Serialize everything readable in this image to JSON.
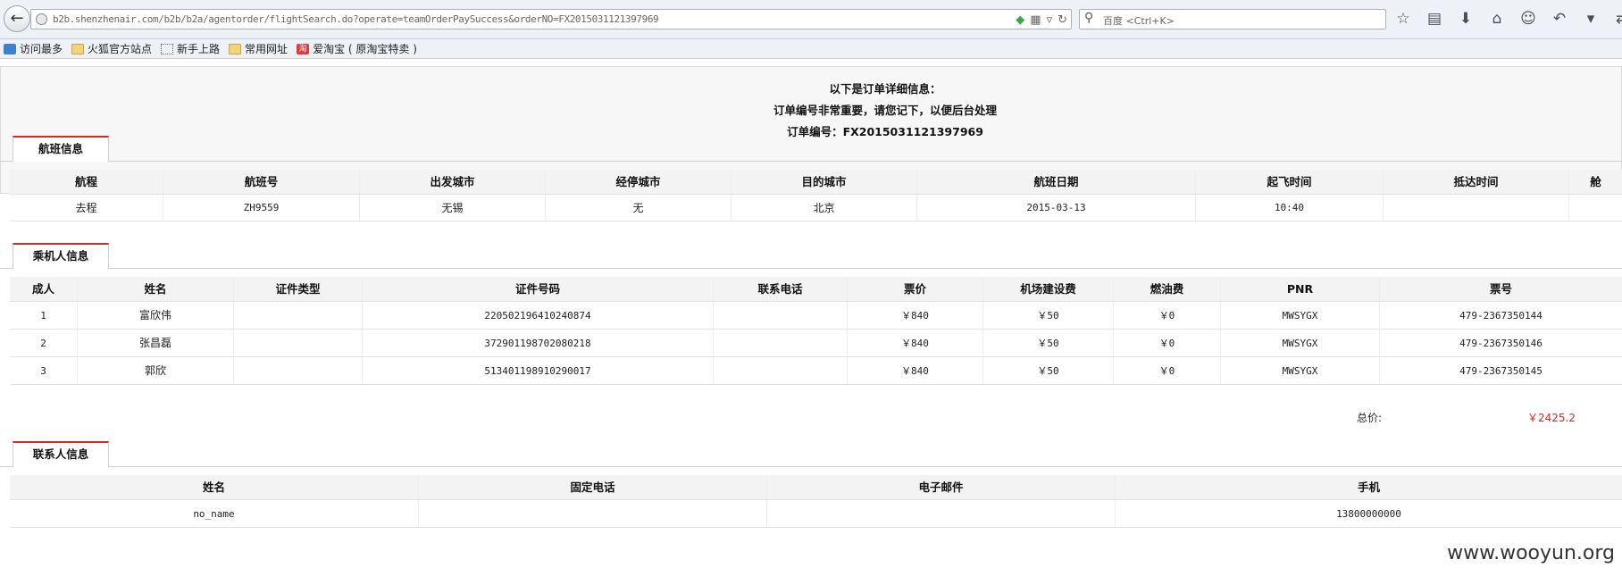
{
  "browser": {
    "url": "b2b.shenzhenair.com/b2b/b2a/agentorder/flightSearch.do?operate=teamOrderPaySuccess&orderNO=FX2015031121397969",
    "search_placeholder": "百度 <Ctrl+K>",
    "bookmarks": [
      {
        "label": "访问最多",
        "icon": "magnifier-bookmark-icon"
      },
      {
        "label": "火狐官方站点",
        "icon": "folder-icon"
      },
      {
        "label": "新手上路",
        "icon": "dotted-page-icon"
      },
      {
        "label": "常用网址",
        "icon": "folder-icon"
      },
      {
        "label": "爱淘宝 ( 原淘宝特卖 )",
        "icon": "taobao-icon"
      }
    ]
  },
  "notice": {
    "line1": "以下是订单详细信息：",
    "line2": "订单编号非常重要，请您记下，以便后台处理",
    "line3": "订单编号：FX2015031121397969"
  },
  "flight": {
    "tab": "航班信息",
    "headers": [
      "航程",
      "航班号",
      "出发城市",
      "经停城市",
      "目的城市",
      "航班日期",
      "起飞时间",
      "抵达时间",
      "舱"
    ],
    "rows": [
      [
        "去程",
        "ZH9559",
        "无锡",
        "无",
        "北京",
        "2015-03-13",
        "10:40",
        "",
        ""
      ]
    ]
  },
  "passenger": {
    "tab": "乘机人信息",
    "headers": [
      "成人",
      "姓名",
      "证件类型",
      "证件号码",
      "联系电话",
      "票价",
      "机场建设费",
      "燃油费",
      "PNR",
      "票号"
    ],
    "rows": [
      [
        "1",
        "富欣伟",
        "",
        "220502196410240874",
        "",
        "￥840",
        "￥50",
        "￥0",
        "MWSYGX",
        "479-2367350144"
      ],
      [
        "2",
        "张昌磊",
        "",
        "372901198702080218",
        "",
        "￥840",
        "￥50",
        "￥0",
        "MWSYGX",
        "479-2367350146"
      ],
      [
        "3",
        "郭欣",
        "",
        "513401198910290017",
        "",
        "￥840",
        "￥50",
        "￥0",
        "MWSYGX",
        "479-2367350145"
      ]
    ],
    "total_label": "总价:",
    "total_value": "￥2425.2"
  },
  "contact": {
    "tab": "联系人信息",
    "headers": [
      "姓名",
      "固定电话",
      "电子邮件",
      "手机"
    ],
    "rows": [
      [
        "no_name",
        "",
        "",
        "13800000000"
      ]
    ]
  },
  "watermark": "www.wooyun.org"
}
